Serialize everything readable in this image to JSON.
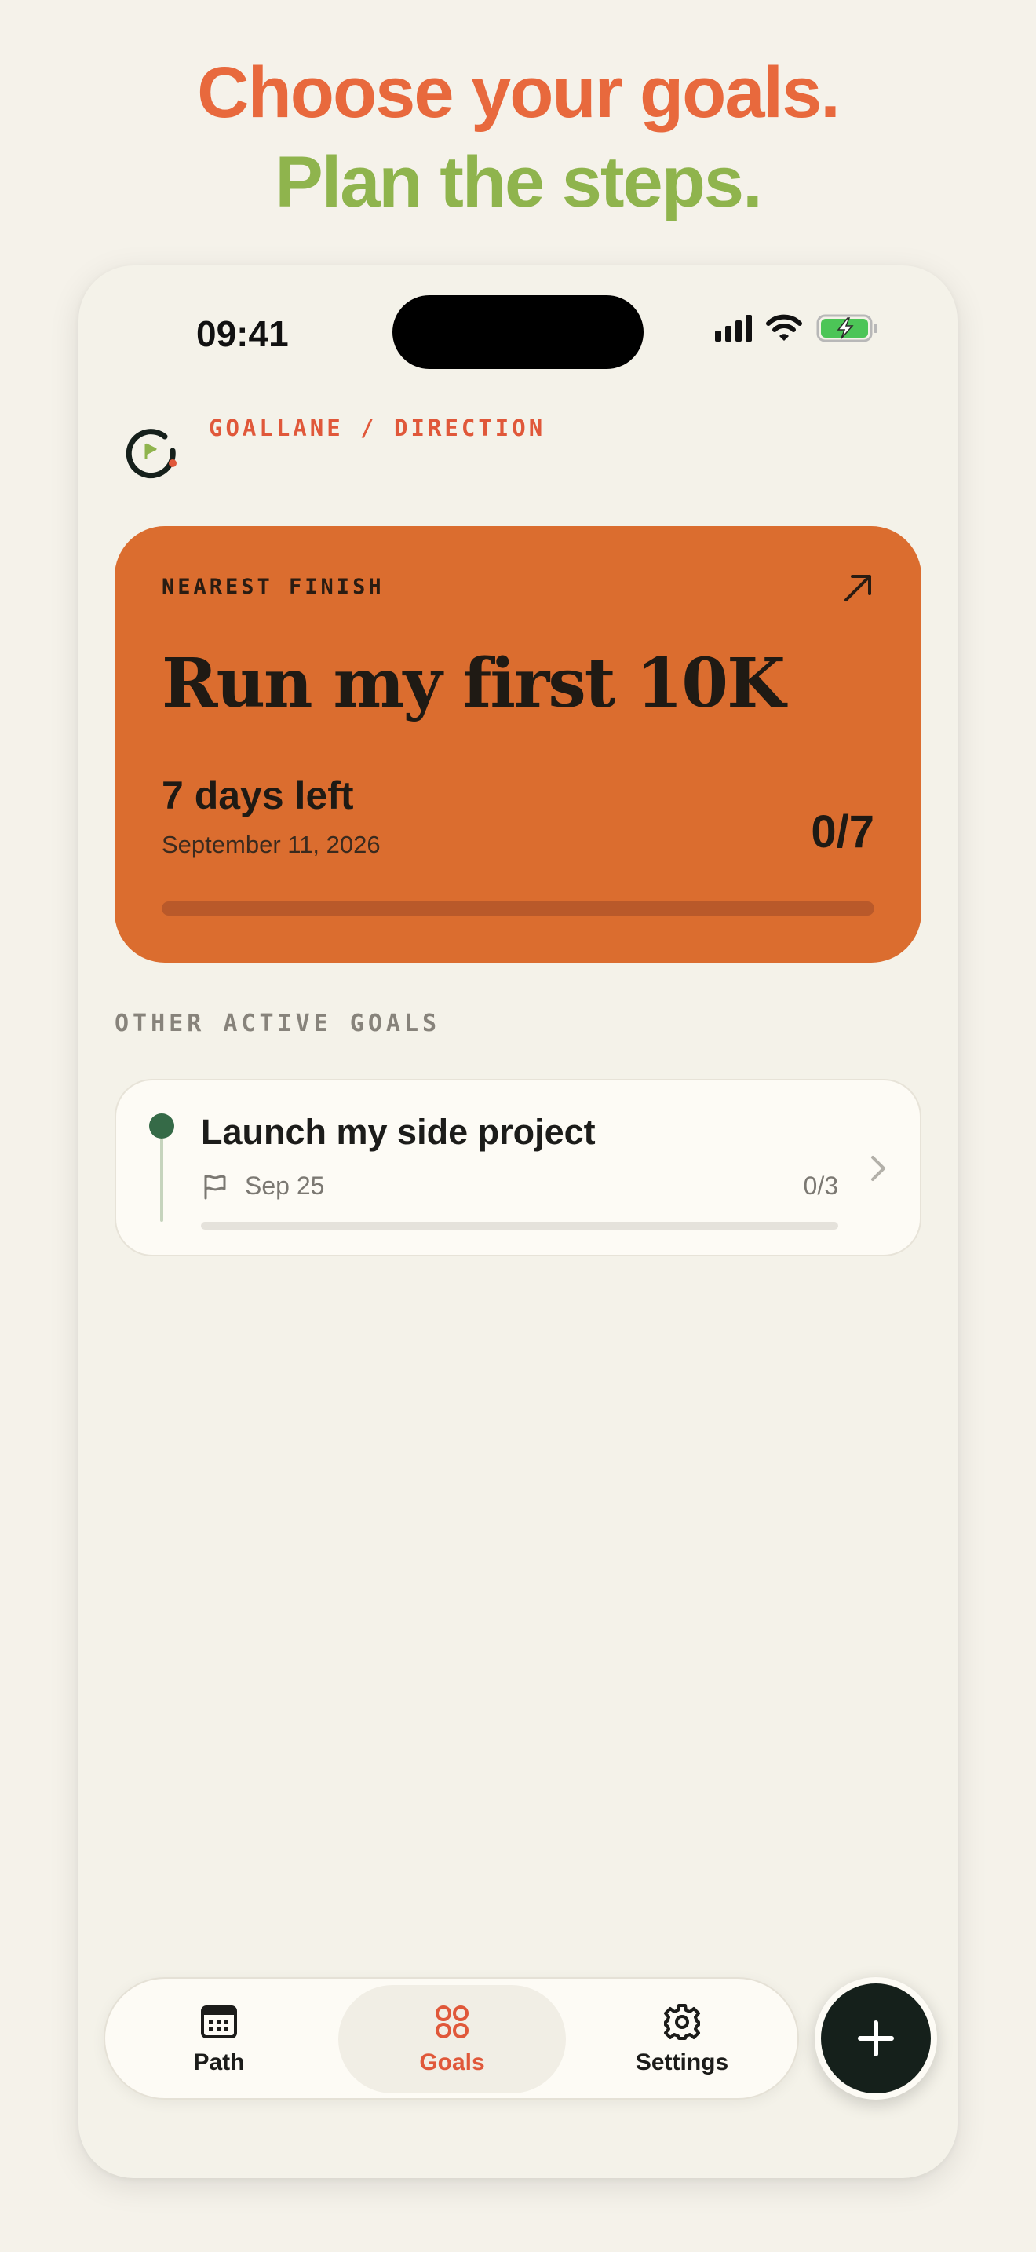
{
  "promo": {
    "line1": "Choose your goals.",
    "line2": "Plan the steps.",
    "colors": {
      "line1": "#e8693d",
      "line2": "#8fb44d"
    }
  },
  "status_bar": {
    "time": "09:41",
    "icons": [
      "cellular-signal-icon",
      "wifi-icon",
      "battery-charging-icon"
    ]
  },
  "header": {
    "logo_icon": "goallane-logo-icon",
    "brand": "GOALLANE / DIRECTION"
  },
  "featured_goal": {
    "label": "NEAREST FINISH",
    "title": "Run my first 10K",
    "days_left": "7 days left",
    "date": "September 11, 2026",
    "progress_text": "0/7",
    "progress": 0,
    "arrow_icon": "arrow-up-right-icon",
    "color": "#db6d2f"
  },
  "other_goals": {
    "label": "OTHER ACTIVE GOALS",
    "items": [
      {
        "title": "Launch my side project",
        "date": "Sep 25",
        "progress_text": "0/3",
        "progress": 0,
        "color": "#356a47"
      }
    ]
  },
  "tabbar": {
    "tabs": [
      {
        "label": "Path",
        "icon": "calendar-icon",
        "active": false
      },
      {
        "label": "Goals",
        "icon": "grid-circles-icon",
        "active": true
      },
      {
        "label": "Settings",
        "icon": "gear-icon",
        "active": false
      }
    ],
    "active_color": "#e0583a",
    "fab_icon": "plus-icon"
  }
}
